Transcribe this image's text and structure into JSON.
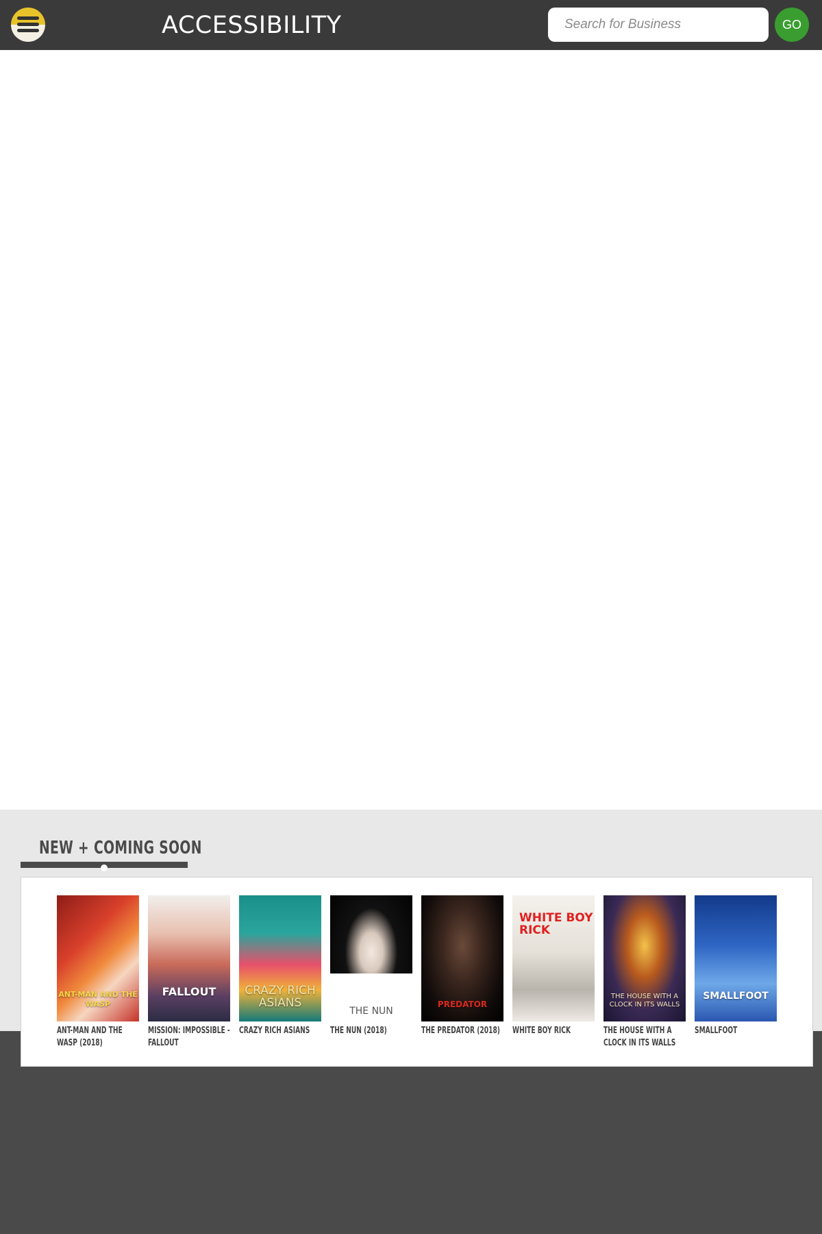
{
  "header": {
    "title": "ACCESSIBILITY",
    "search_placeholder": "Search for Business",
    "go_label": "GO"
  },
  "section": {
    "heading": "NEW + COMING SOON"
  },
  "movies": [
    {
      "title": "ANT-MAN AND THE WASP (2018)",
      "poster_text": "ANT-MAN AND THE WASP"
    },
    {
      "title": "MISSION: IMPOSSIBLE - FALLOUT",
      "poster_text": "FALLOUT"
    },
    {
      "title": "CRAZY RICH ASIANS",
      "poster_text": "CRAZY RICH ASIANS"
    },
    {
      "title": "THE NUN (2018)",
      "poster_text": "THE NUN"
    },
    {
      "title": "THE PREDATOR (2018)",
      "poster_text": "PREDATOR"
    },
    {
      "title": "WHITE BOY RICK",
      "poster_text": "WHITE BOY RICK"
    },
    {
      "title": "THE HOUSE WITH A CLOCK IN ITS WALLS",
      "poster_text": "THE HOUSE WITH A CLOCK IN ITS WALLS"
    },
    {
      "title": "SMALLFOOT",
      "poster_text": "SMALLFOOT"
    }
  ]
}
